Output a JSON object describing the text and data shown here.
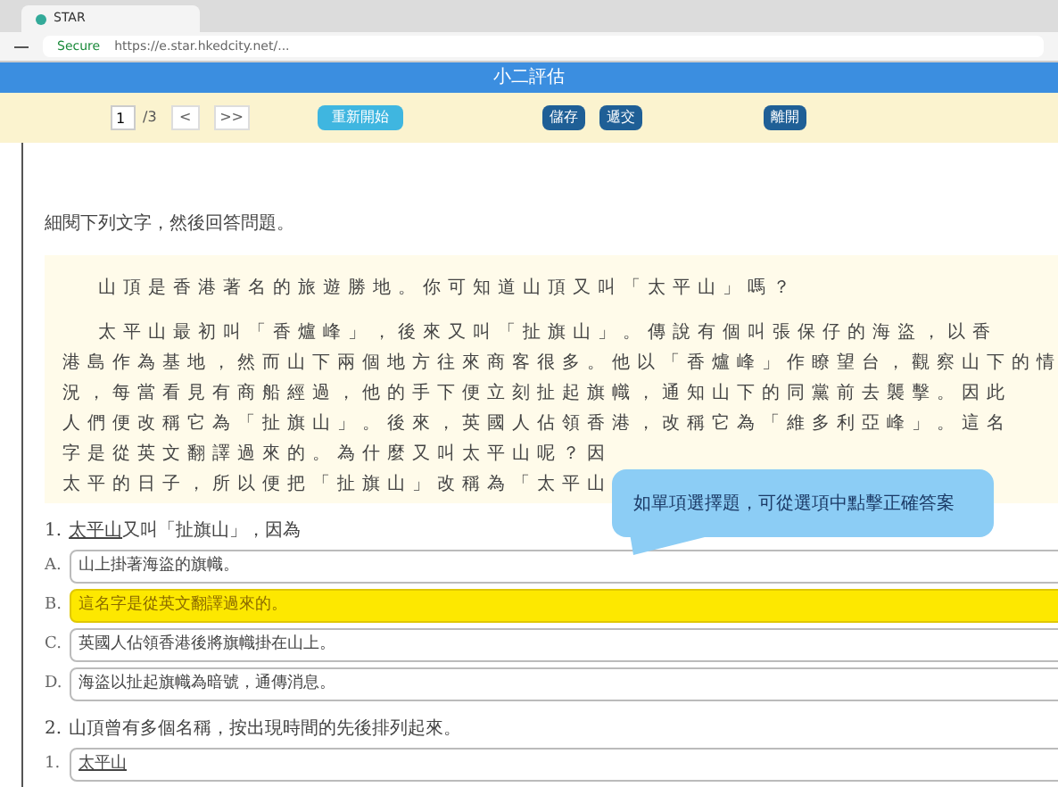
{
  "browser": {
    "tab_title": "STAR",
    "security": "Secure",
    "url": "https://e.star.hkedcity.net/..."
  },
  "app": {
    "title": "小二評估"
  },
  "toolbar": {
    "page_value": "1",
    "page_total": "/3",
    "prev": "<",
    "next": ">>",
    "buttons": [
      {
        "label": "重新開始",
        "kind": "light"
      },
      {
        "label": "儲存",
        "kind": "dark"
      },
      {
        "label": "遞交",
        "kind": "dark"
      },
      {
        "label": "離開",
        "kind": "dark"
      }
    ]
  },
  "instruction": "細閱下列文字，然後回答問題。",
  "passage": [
    {
      "lines": [
        "山頂是香港著名的旅遊勝地。你可知道山頂又叫「太平山」嗎？"
      ]
    },
    {
      "lines": [
        "太平山最初叫「香爐峰」，後來又叫「扯旗山」。傳說有個叫張保仔的海盜，以香",
        "港島作為基地，然而山下兩個地方往來商客很多。他以「香爐峰」作瞭望台，觀察山下的情",
        "況，每當看見有商船經過，他的手下便立刻扯起旗幟，通知山下的同黨前去襲擊。因此",
        "人們便改稱它為「扯旗山」。後來，英國人佔領香港，改稱它為「維多利亞峰」。這名",
        "字是從英文翻譯過來的。為什麼又叫太平山呢？因",
        "太平的日子，所以便把「扯旗山」改稱為「太平山"
      ]
    }
  ],
  "questions": [
    {
      "number": "1.",
      "underlined": "太平山",
      "prompt": "又叫「扯旗山」，因為",
      "options": [
        {
          "label": "A.",
          "text": "山上掛著海盜的旗幟。",
          "selected": false
        },
        {
          "label": "B.",
          "text": "這名字是從英文翻譯過來的。",
          "selected": true
        },
        {
          "label": "C.",
          "text": "英國人佔領香港後將旗幟掛在山上。",
          "selected": false
        },
        {
          "label": "D.",
          "text": "海盜以扯起旗幟為暗號，通傳消息。",
          "selected": false
        }
      ]
    },
    {
      "number": "2.",
      "prompt": "山頂曾有多個名稱，按出現時間的先後排列起來。",
      "options": [
        {
          "label": "1.",
          "text": "太平山",
          "selected": false
        }
      ]
    }
  ],
  "callout": "如單項選擇題，可從選項中點擊正確答案"
}
